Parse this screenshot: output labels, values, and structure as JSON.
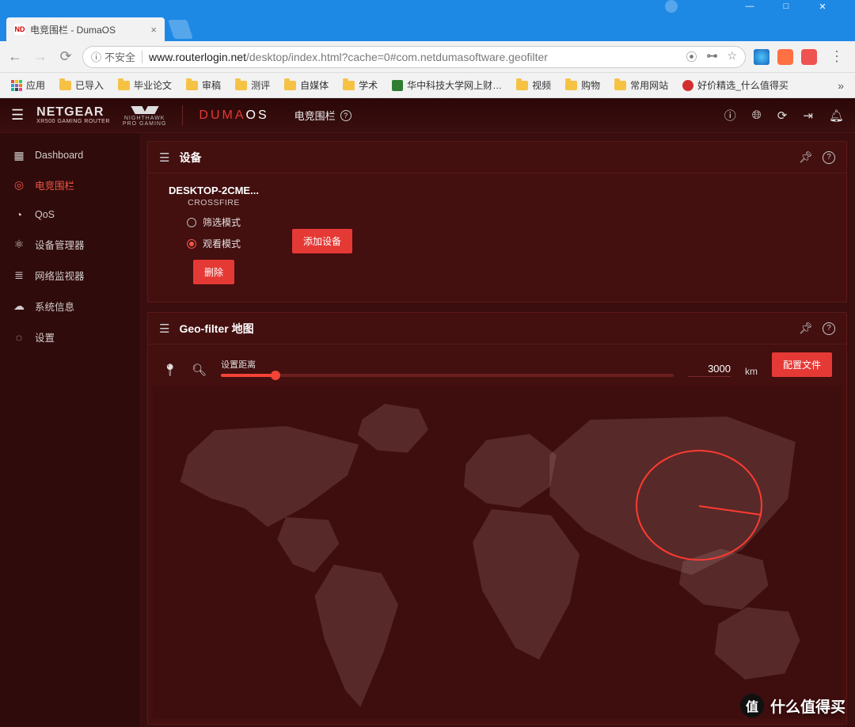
{
  "window": {
    "tab_title": "电竞围栏 - DumaOS",
    "favicon_text": "ND"
  },
  "omnibox": {
    "insecure_label": "不安全",
    "host": "www.routerlogin.net",
    "path": "/desktop/index.html?cache=0#com.netdumasoftware.geofilter"
  },
  "bookmarks": {
    "apps": "应用",
    "items": [
      "已导入",
      "毕业论文",
      "审稿",
      "测评",
      "自媒体",
      "学术"
    ],
    "site1": "华中科技大学网上财…",
    "more_folders": [
      "视频",
      "购物",
      "常用网站"
    ],
    "site2": "好价精选_什么值得买"
  },
  "brand": {
    "name": "NETGEAR",
    "sub": "XR500 GAMING ROUTER",
    "nh1": "NIGHTHAWK",
    "nh2": "PRO GAMING",
    "duma1": "DUMA",
    "duma2": "OS"
  },
  "crumb": {
    "label": "电竞围栏"
  },
  "sidebar": {
    "items": [
      {
        "icon": "▦",
        "label": "Dashboard"
      },
      {
        "icon": "◎",
        "label": "电竞围栏"
      },
      {
        "icon": "◔",
        "label": "QoS"
      },
      {
        "icon": "⚛",
        "label": "设备管理器"
      },
      {
        "icon": "≣",
        "label": "网络监视器"
      },
      {
        "icon": "☁",
        "label": "系统信息"
      },
      {
        "icon": "◌",
        "label": "设置"
      }
    ]
  },
  "devices_panel": {
    "title": "设备",
    "device_name": "DESKTOP-2CME...",
    "device_sub": "CROSSFIRE",
    "mode_filter": "筛选模式",
    "mode_watch": "观看模式",
    "delete": "删除",
    "add": "添加设备"
  },
  "geo_panel": {
    "title": "Geo-filter 地图",
    "slider_label": "设置距离",
    "distance": "3000",
    "unit": "km",
    "profile_btn": "配置文件"
  },
  "watermark": {
    "badge": "值",
    "text": "什么值得买"
  }
}
